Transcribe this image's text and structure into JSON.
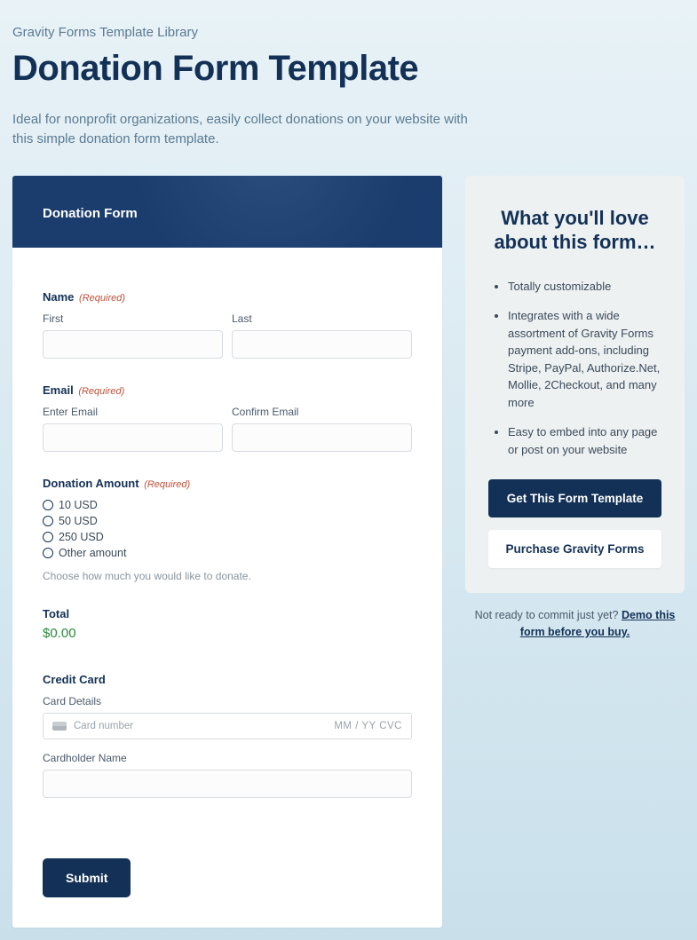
{
  "breadcrumb": "Gravity Forms Template Library",
  "page_title": "Donation Form Template",
  "page_desc": "Ideal for nonprofit organizations, easily collect donations on your website with this simple donation form template.",
  "form": {
    "header": "Donation Form",
    "required_text": "(Required)",
    "name": {
      "label": "Name",
      "first": "First",
      "last": "Last"
    },
    "email": {
      "label": "Email",
      "enter": "Enter Email",
      "confirm": "Confirm Email"
    },
    "amount": {
      "label": "Donation Amount",
      "options": [
        "10 USD",
        "50 USD",
        "250 USD",
        "Other amount"
      ],
      "hint": "Choose how much you would like to donate."
    },
    "total": {
      "label": "Total",
      "value": "$0.00"
    },
    "cc": {
      "label": "Credit Card",
      "details_label": "Card Details",
      "placeholder": "Card number",
      "right": "MM / YY  CVC",
      "holder_label": "Cardholder Name"
    },
    "submit": "Submit"
  },
  "sidebar": {
    "title": "What you'll love about this form…",
    "bullets": [
      "Totally customizable",
      "Integrates with a wide assortment of Gravity Forms payment add-ons, including Stripe, PayPal, Authorize.Net, Mollie, 2Checkout, and many more",
      "Easy to embed into any page or post on your website"
    ],
    "cta_primary": "Get This Form Template",
    "cta_secondary": "Purchase Gravity Forms",
    "demo_prefix": "Not ready to commit just yet? ",
    "demo_link": "Demo this form before you buy."
  }
}
